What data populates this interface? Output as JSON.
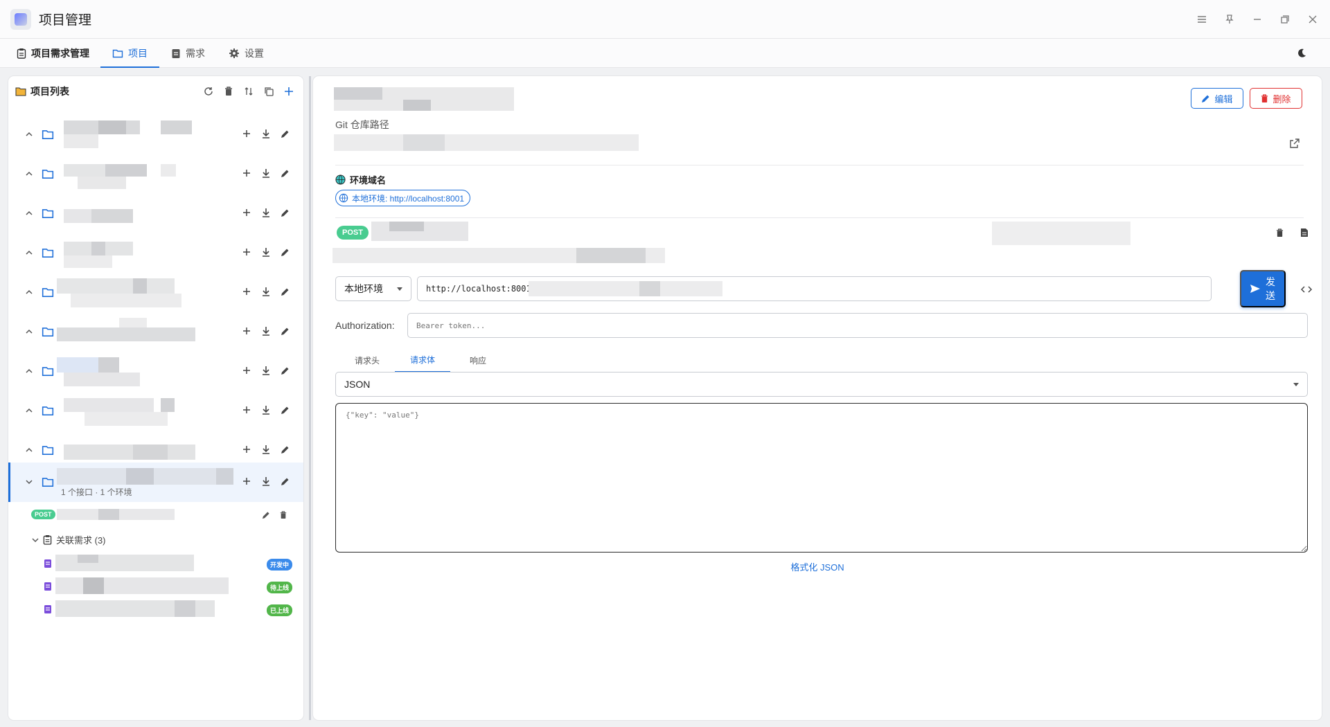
{
  "window": {
    "title": "项目管理",
    "controls": [
      "menu-icon",
      "pin-icon",
      "minimize-icon",
      "restore-icon",
      "close-icon"
    ]
  },
  "nav": {
    "brand": "项目需求管理",
    "tabs": [
      {
        "label": "项目",
        "icon": "folder-icon",
        "active": true
      },
      {
        "label": "需求",
        "icon": "clipboard-icon",
        "active": false
      },
      {
        "label": "设置",
        "icon": "gear-icon",
        "active": false
      }
    ]
  },
  "sidebar": {
    "title": "项目列表",
    "actions": [
      "refresh-icon",
      "trash-icon",
      "sort-icon",
      "copy-icon",
      "plus-icon"
    ],
    "selected_summary": "1 个接口 · 1 个环境",
    "endpoint_method": "POST",
    "related_header": "关联需求 (3)",
    "requirements": [
      {
        "status": "开发中",
        "color": "#3b8beb"
      },
      {
        "status": "待上线",
        "color": "#52b64a"
      },
      {
        "status": "已上线",
        "color": "#52b64a"
      }
    ]
  },
  "detail": {
    "edit_label": "编辑",
    "delete_label": "删除",
    "git_label": "Git 仓库路径",
    "env_title": "环境域名",
    "env_chip": "本地环境: http://localhost:8001",
    "method": "POST"
  },
  "request": {
    "env_select": "本地环境",
    "url": "http://localhost:8001",
    "send_label_1": "发",
    "send_label_2": "送",
    "auth_label": "Authorization:",
    "auth_placeholder": "Bearer token...",
    "tabs": [
      {
        "label": "请求头",
        "active": false
      },
      {
        "label": "请求体",
        "active": true
      },
      {
        "label": "响应",
        "active": false
      }
    ],
    "body_type": "JSON",
    "body_placeholder": "{\"key\": \"value\"}",
    "format_label": "格式化 JSON"
  },
  "colors": {
    "accent": "#1e6fd9",
    "post": "#49cc90",
    "danger": "#e03131",
    "req_icon": "#7b4ddb"
  }
}
